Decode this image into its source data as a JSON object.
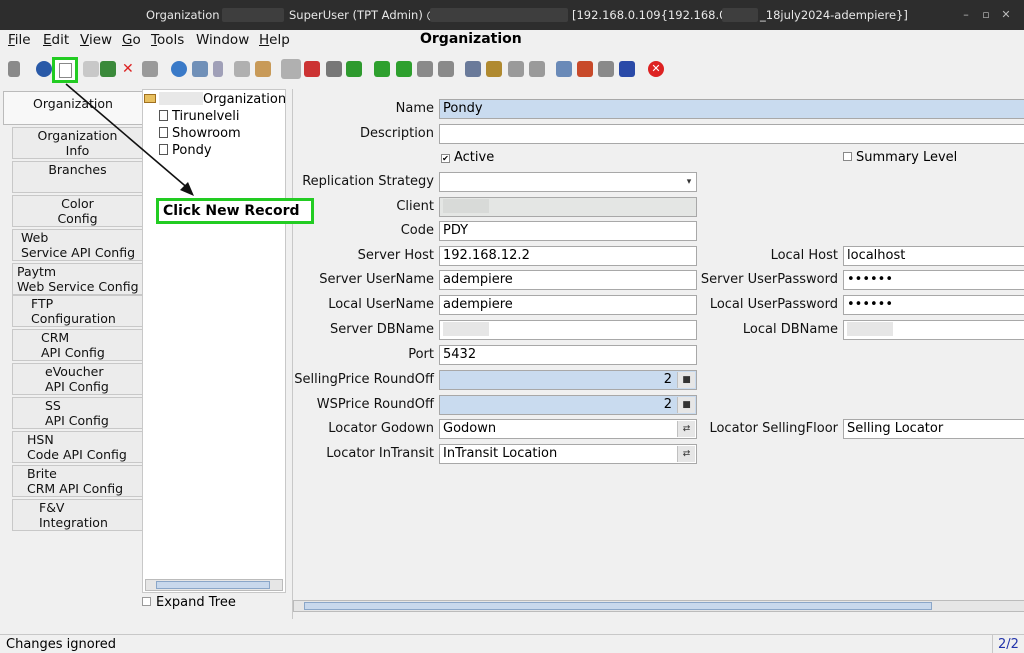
{
  "titlebar": {
    "left": "Organization",
    "center": "SuperUser (TPT Admin) @",
    "right": "[192.168.0.109{192.168.0.109-",
    "right_end": "_18july2024-adempiere}]"
  },
  "menu": {
    "items": [
      {
        "label": "File",
        "u": "F",
        "rest": "ile"
      },
      {
        "label": "Edit",
        "u": "E",
        "rest": "dit"
      },
      {
        "label": "View",
        "u": "V",
        "rest": "iew"
      },
      {
        "label": "Go",
        "u": "G",
        "rest": "o"
      },
      {
        "label": "Tools",
        "u": "T",
        "rest": "ools"
      },
      {
        "label": "Window",
        "u": "",
        "rest": "Window"
      },
      {
        "label": "Help",
        "u": "H",
        "rest": "elp"
      }
    ],
    "window_title": "Organization"
  },
  "tabs": [
    {
      "label": "Organization"
    },
    {
      "label": "Organization\nInfo"
    },
    {
      "label": "Branches"
    },
    {
      "label": "Color\nConfig"
    },
    {
      "label": "Web\nService API Config"
    },
    {
      "label": "Paytm\nWeb Service Config"
    },
    {
      "label": "FTP\nConfiguration"
    },
    {
      "label": "CRM\nAPI Config"
    },
    {
      "label": "eVoucher\nAPI Config"
    },
    {
      "label": "SS\nAPI Config"
    },
    {
      "label": "HSN\nCode API Config"
    },
    {
      "label": "Brite\nCRM API Config"
    },
    {
      "label": "F&V\nIntegration"
    }
  ],
  "tree": {
    "root": "Organization",
    "nodes": [
      "Tirunelveli",
      "Showroom",
      "Pondy"
    ],
    "expand_label": "Expand Tree"
  },
  "form": {
    "name_label": "Name",
    "name_value": "Pondy",
    "description_label": "Description",
    "description_value": "",
    "active_label": "Active",
    "summary_label": "Summary Level",
    "replication_label": "Replication Strategy",
    "replication_value": "",
    "client_label": "Client",
    "code_label": "Code",
    "code_value": "PDY",
    "server_host_label": "Server Host",
    "server_host_value": "192.168.12.2",
    "local_host_label": "Local Host",
    "local_host_value": "localhost",
    "server_user_label": "Server UserName",
    "server_user_value": "adempiere",
    "server_pass_label": "Server UserPassword",
    "server_pass_value": "••••••",
    "local_user_label": "Local UserName",
    "local_user_value": "adempiere",
    "local_pass_label": "Local UserPassword",
    "local_pass_value": "••••••",
    "server_db_label": "Server DBName",
    "local_db_label": "Local DBName",
    "port_label": "Port",
    "port_value": "5432",
    "selling_round_label": "SellingPrice RoundOff",
    "selling_round_value": "2",
    "ws_round_label": "WSPrice RoundOff",
    "ws_round_value": "2",
    "godown_label": "Locator Godown",
    "godown_value": "Godown",
    "selling_floor_label": "Locator SellingFloor",
    "selling_floor_value": "Selling Locator",
    "intransit_label": "Locator InTransit",
    "intransit_value": "InTransit Location"
  },
  "annotation": {
    "text": "Click New Record",
    "color": "#22cc22"
  },
  "status": {
    "message": "Changes ignored",
    "page": "2/2"
  }
}
